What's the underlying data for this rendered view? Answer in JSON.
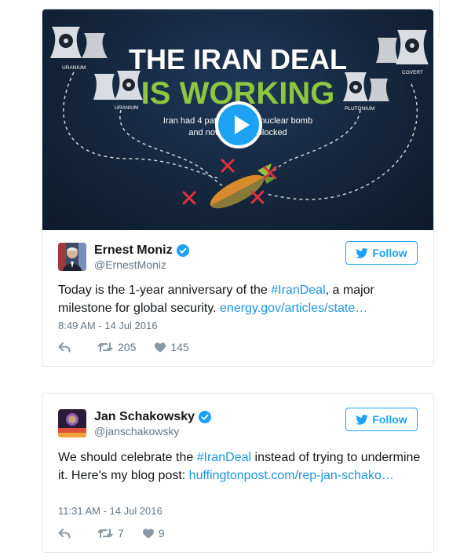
{
  "tweets": [
    {
      "media": {
        "line1": "THE IRAN DEAL",
        "line2": "IS WORKING",
        "sub1": "Iran had 4 pathways to a nuclear bomb",
        "sub2": "and now they are blocked",
        "labels": [
          "URANIUM",
          "URANIUM",
          "PLUTONIUM",
          "COVERT"
        ],
        "colors": {
          "title": "#ffffff",
          "working": "#8dc63f",
          "x_mark": "#e0303e"
        }
      },
      "name": "Ernest Moniz",
      "handle": "@ErnestMoniz",
      "follow_label": "Follow",
      "text_before": "Today is the 1-year anniversary of the ",
      "hashtag": "#IranDeal",
      "text_after": ", a major milestone for global security. ",
      "link": "energy.gov/articles/state…",
      "timestamp": "8:49 AM - 14 Jul 2016",
      "retweets": "205",
      "likes": "145"
    },
    {
      "name": "Jan Schakowsky",
      "handle": "@janschakowsky",
      "follow_label": "Follow",
      "text_before": "We should celebrate the ",
      "hashtag": "#IranDeal",
      "text_after": " instead of trying to undermine it. Here's my blog post: ",
      "link": "huffingtonpost.com/rep-jan-schako…",
      "timestamp": "11:31 AM - 14 Jul 2016",
      "retweets": "7",
      "likes": "9"
    }
  ],
  "colors": {
    "accent": "#1da1f2",
    "link": "#1b95e0",
    "muted": "#657786"
  },
  "icons": [
    "reply-icon",
    "retweet-icon",
    "like-icon",
    "twitter-bird-icon",
    "verified-icon",
    "play-icon"
  ]
}
